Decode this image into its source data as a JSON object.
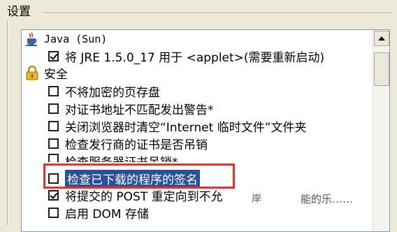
{
  "group": {
    "title": "设置"
  },
  "items": {
    "java_header": "Java (Sun)",
    "jre_option": "将 JRE 1.5.0_17 用于 <applet>(需要重新启动)",
    "security_header": "安全",
    "opt1": "不将加密的页存盘",
    "opt2": "对证书地址不匹配发出警告*",
    "opt3": "关闭浏览器时清空“Internet 临时文件”文件夹",
    "opt4": "检查发行商的证书是否吊销",
    "opt5": "检查服务器证书吊销*",
    "opt6": "检查已下载的程序的签名",
    "opt7": "将提交的 POST 重定向到不允",
    "opt8": "启用 DOM 存储"
  },
  "overlay": {
    "watermark_prefix": "岸",
    "watermark_text": "能的乐……"
  },
  "states": {
    "jre_option": true,
    "opt1": false,
    "opt2": false,
    "opt3": false,
    "opt4": false,
    "opt5": false,
    "opt6": false,
    "opt7": true,
    "opt8": false
  },
  "colors": {
    "selection": "#2a4f9b",
    "highlight_border": "#e8302a",
    "window_bg": "#ece9d8"
  },
  "icons": {
    "java": "java-coffee-cup-icon",
    "security": "padlock-icon",
    "scroll_up": "triangle-up-icon"
  }
}
